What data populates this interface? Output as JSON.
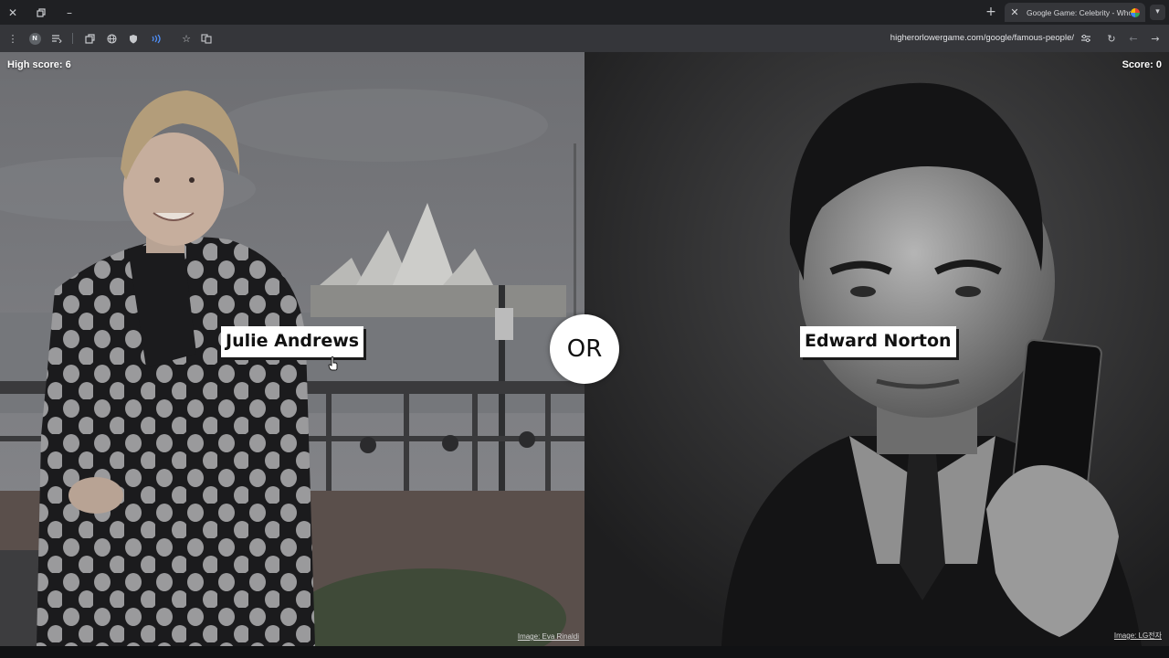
{
  "browser": {
    "tab": {
      "title": "Google Game: Celebrity - Who"
    },
    "url": "higherorlowergame.com/google/famous-people/",
    "profile_initial": "N"
  },
  "game": {
    "high_score_label": "High score: 6",
    "score_label": "Score: 0",
    "or_label": "OR",
    "left": {
      "name": "Julie Andrews",
      "image_credit": "Image: Eva Rinaldi"
    },
    "right": {
      "name": "Edward Norton",
      "image_credit": "Image: LG전자"
    }
  }
}
